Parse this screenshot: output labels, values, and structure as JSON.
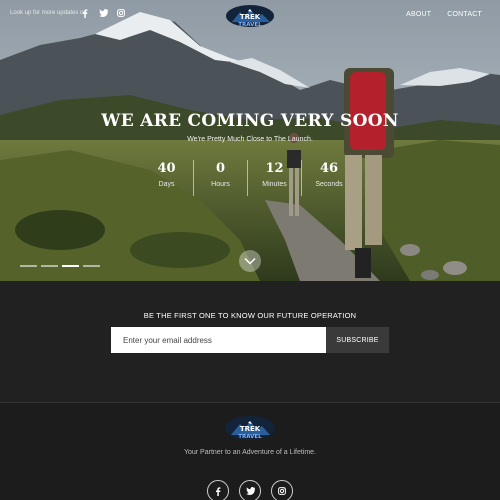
{
  "topbar": {
    "lookup_text": "Look up for more updates on",
    "social": [
      "facebook-icon",
      "twitter-icon",
      "instagram-icon"
    ]
  },
  "logo": {
    "line1": "TREK",
    "line2": "TRAVEL"
  },
  "nav": {
    "about": "ABOUT",
    "contact": "CONTACT"
  },
  "hero": {
    "headline": "WE ARE COMING VERY SOON",
    "subheadline": "We're Pretty Much Close to The Launch.",
    "countdown": [
      {
        "value": "40",
        "label": "Days"
      },
      {
        "value": "0",
        "label": "Hours"
      },
      {
        "value": "12",
        "label": "Minutes"
      },
      {
        "value": "46",
        "label": "Seconds"
      }
    ],
    "slides": 4,
    "active_slide": 3
  },
  "subscribe": {
    "title": "BE THE FIRST ONE TO KNOW OUR FUTURE OPERATION",
    "email_placeholder": "Enter your email address",
    "button": "SUBSCRIBE"
  },
  "footer": {
    "tagline": "Your Partner to an Adventure of a Lifetime.",
    "social": [
      "facebook-icon",
      "twitter-icon",
      "instagram-icon"
    ]
  },
  "colors": {
    "dark_bg": "#212121",
    "button_bg": "#3a3a3a",
    "logo_blue": "#2a5f9e"
  }
}
